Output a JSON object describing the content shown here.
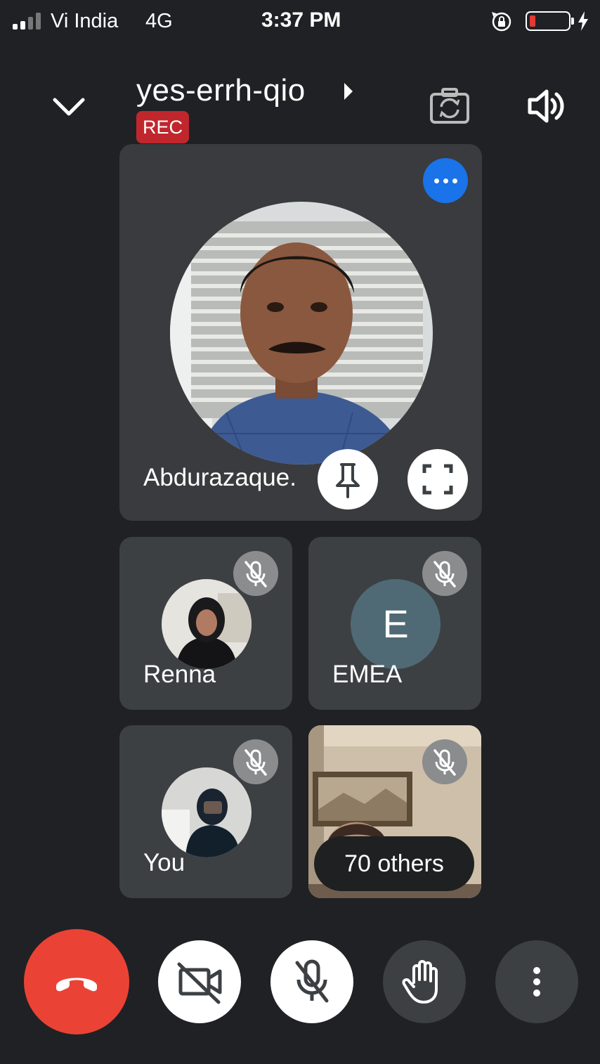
{
  "status_bar": {
    "carrier": "Vi India",
    "network": "4G",
    "time": "3:37 PM",
    "battery_level": 0.15,
    "charging": true
  },
  "header": {
    "meeting_code": "yes-errh-qio",
    "rec_label": "REC"
  },
  "main_tile": {
    "name": "Abdurazaque."
  },
  "tiles": [
    {
      "name": "Renna",
      "mic": "muted"
    },
    {
      "name": "EMEA",
      "initial": "E",
      "mic": "muted"
    },
    {
      "name": "You",
      "mic": "muted"
    },
    {
      "others_label": "70 others",
      "mic": "muted"
    }
  ],
  "colors": {
    "background": "#202124",
    "tile": "#3c4043",
    "rec": "#c0272d",
    "accent_blue": "#1a73e8",
    "end_call": "#ea4335"
  },
  "icons": {
    "collapse": "chevron-down-icon",
    "switch_camera": "switch-camera-icon",
    "speaker": "speaker-icon",
    "pin": "pin-icon",
    "fullscreen": "fullscreen-icon",
    "mic_off": "mic-off-icon",
    "end_call": "phone-hangup-icon",
    "camera_off": "camera-off-icon",
    "raise_hand": "hand-icon",
    "more": "more-vertical-icon"
  }
}
